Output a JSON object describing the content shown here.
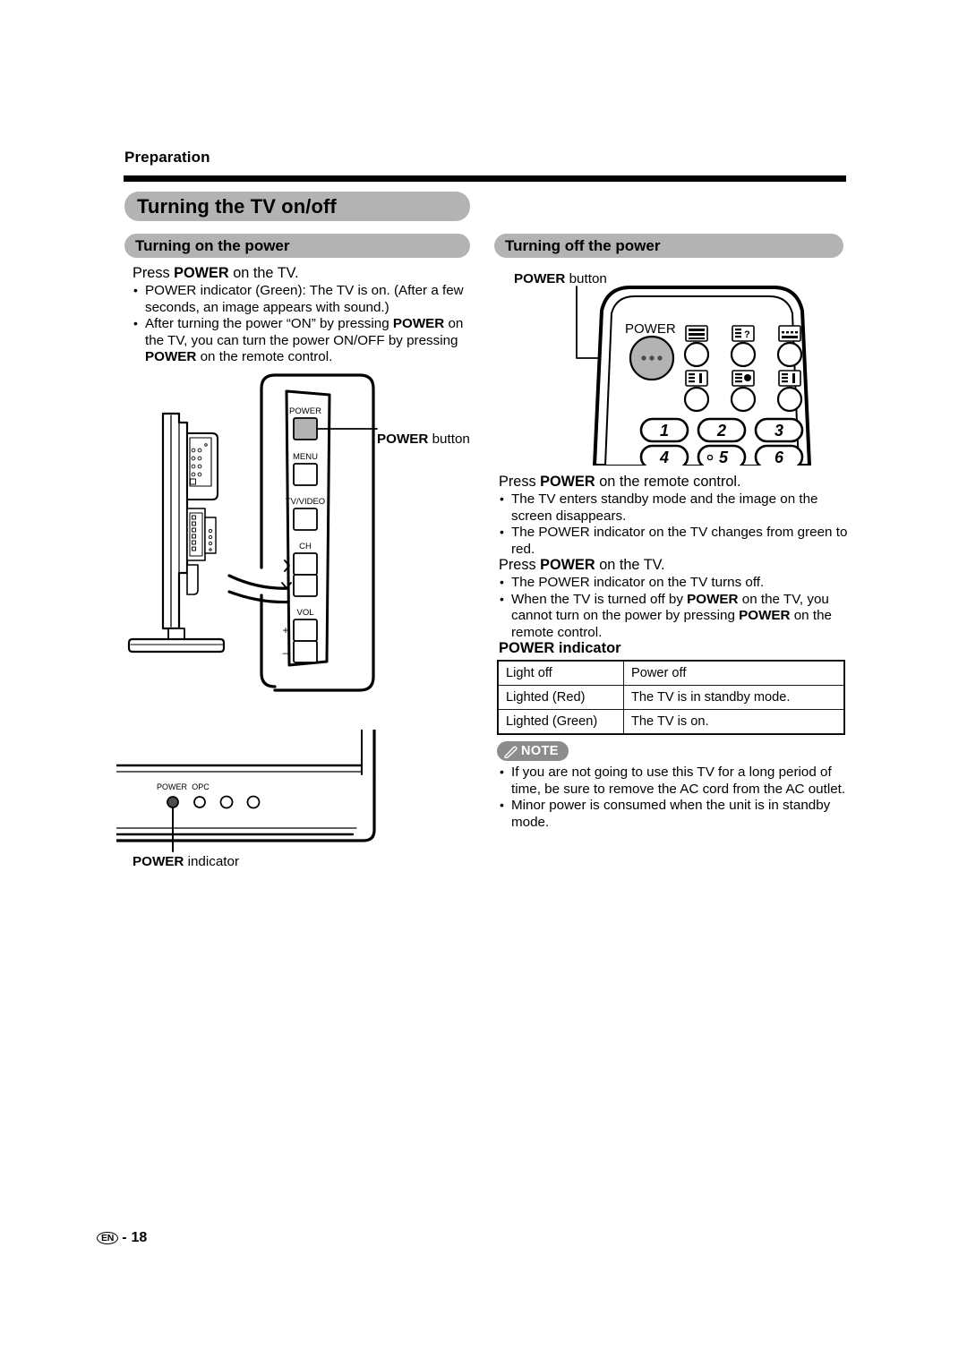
{
  "page": {
    "kicker": "Preparation",
    "footer": {
      "locale": "EN",
      "dash": "-",
      "page_number": "18"
    }
  },
  "headings": {
    "main": "Turning the TV on/off",
    "left_section": "Turning on the power",
    "right_section": "Turning off the power"
  },
  "left_column": {
    "lead": {
      "pre": "Press ",
      "bold": "POWER",
      "post": " on the TV."
    },
    "bullets": [
      "POWER indicator (Green): The TV is on. (After a few seconds, an image appears with sound.)",
      "After turning the power “ON” by pressing POWER on the TV, you can turn the power ON/OFF by pressing POWER on the remote control."
    ],
    "callout_power_button": {
      "bold": "POWER",
      "rest": " button"
    },
    "callout_power_indicator": {
      "bold": "POWER",
      "rest": " indicator"
    },
    "tv_panel_labels": {
      "power": "POWER",
      "menu": "MENU",
      "tv_video": "TV/VIDEO",
      "ch": "CH",
      "vol": "VOL",
      "vol_plus": "+",
      "vol_minus": "–"
    },
    "tv_base_labels": {
      "power": "POWER",
      "opc": "OPC"
    }
  },
  "right_column": {
    "callout_power_button": {
      "bold": "POWER",
      "rest": " button"
    },
    "remote": {
      "power_label": "POWER",
      "numbers": [
        "1",
        "2",
        "3",
        "4",
        "5",
        "6"
      ]
    },
    "lead_remote": {
      "pre": "Press ",
      "bold": "POWER",
      "post": " on the remote control."
    },
    "bullets_remote": [
      "The TV enters standby mode and the image on the screen disappears.",
      "The POWER indicator on the TV changes from green to red."
    ],
    "lead_tv": {
      "pre": "Press ",
      "bold": "POWER",
      "post": " on the TV."
    },
    "bullets_tv": [
      "The POWER indicator on the TV turns off.",
      "When the TV is turned off by POWER on the TV, you cannot turn on the power by pressing POWER on the remote control."
    ],
    "table": {
      "title": "POWER indicator",
      "rows": [
        {
          "state": "Light off",
          "meaning": "Power off"
        },
        {
          "state": "Lighted (Red)",
          "meaning": "The TV is in standby mode."
        },
        {
          "state": "Lighted (Green)",
          "meaning": "The TV is on."
        }
      ]
    },
    "note": {
      "label": "NOTE",
      "bullets": [
        "If you are not going to use this TV for a long period of time, be sure to remove the AC cord from the AC outlet.",
        "Minor power is consumed when the unit is in standby mode."
      ]
    }
  },
  "colors": {
    "heading_bar": "#b3b3b3",
    "note_badge": "#8c8c8c",
    "button_fill": "#b3b3b3",
    "ink": "#000000"
  }
}
